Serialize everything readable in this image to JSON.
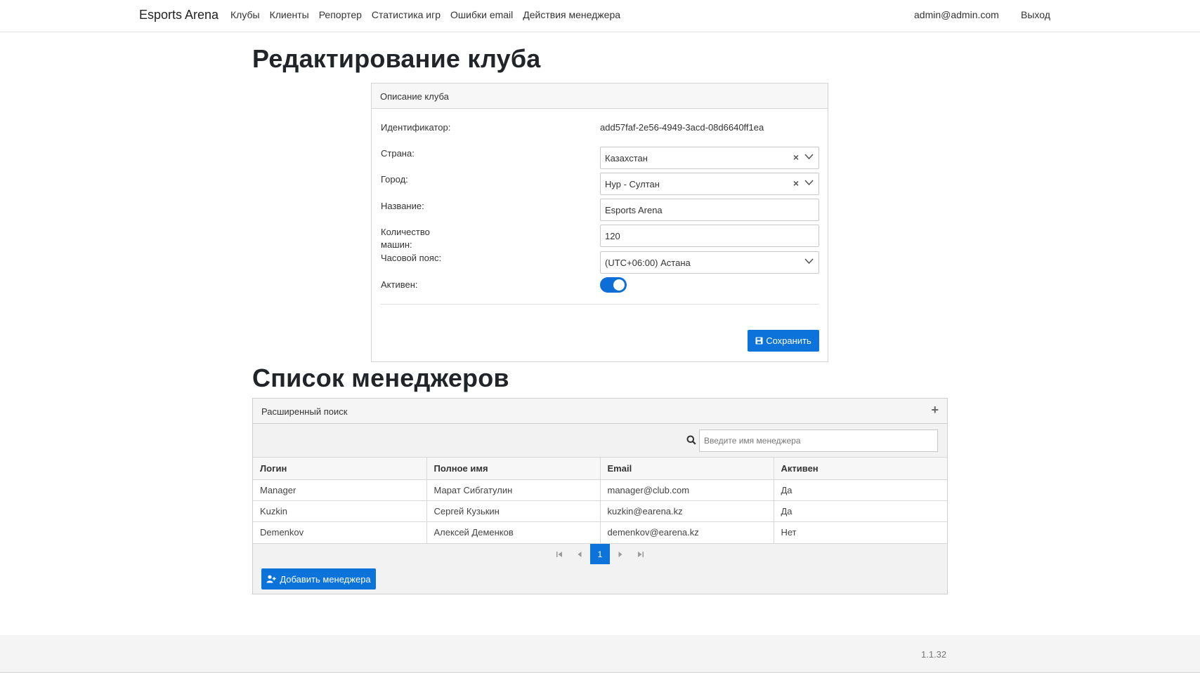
{
  "navbar": {
    "brand": "Esports Arena",
    "links": [
      "Клубы",
      "Клиенты",
      "Репортер",
      "Статистика игр",
      "Ошибки email",
      "Действия менеджера"
    ],
    "user": "admin@admin.com",
    "logout": "Выход"
  },
  "edit_title": "Редактирование клуба",
  "club_form": {
    "header": "Описание клуба",
    "id_label": "Идентификатор:",
    "id_value": "add57faf-2e56-4949-3acd-08d6640ff1ea",
    "country_label": "Страна:",
    "country_value": "Казахстан",
    "city_label": "Город:",
    "city_value": "Нур - Султан",
    "name_label": "Название:",
    "name_value": "Esports Arena",
    "machines_label": "Количество машин:",
    "machines_value": "120",
    "timezone_label": "Часовой пояс:",
    "timezone_value": "(UTC+06:00) Астана",
    "active_label": "Активен:",
    "active_value": true,
    "clear_glyph": "×",
    "save_label": "Сохранить"
  },
  "managers_title": "Список менеджеров",
  "managers": {
    "advanced_search": "Расширенный поиск",
    "expand_glyph": "+",
    "search_placeholder": "Введите имя менеджера",
    "columns": [
      "Логин",
      "Полное имя",
      "Email",
      "Активен"
    ],
    "rows": [
      [
        "Manager",
        "Марат Сибгатулин",
        "manager@club.com",
        "Да"
      ],
      [
        "Kuzkin",
        "Сергей Кузькин",
        "kuzkin@earena.kz",
        "Да"
      ],
      [
        "Demenkov",
        "Алексей Деменков",
        "demenkov@earena.kz",
        "Нет"
      ]
    ],
    "current_page": "1",
    "add_label": "Добавить менеджера"
  },
  "footer": {
    "version": "1.1.32"
  },
  "colors": {
    "primary": "#0b73d9"
  }
}
